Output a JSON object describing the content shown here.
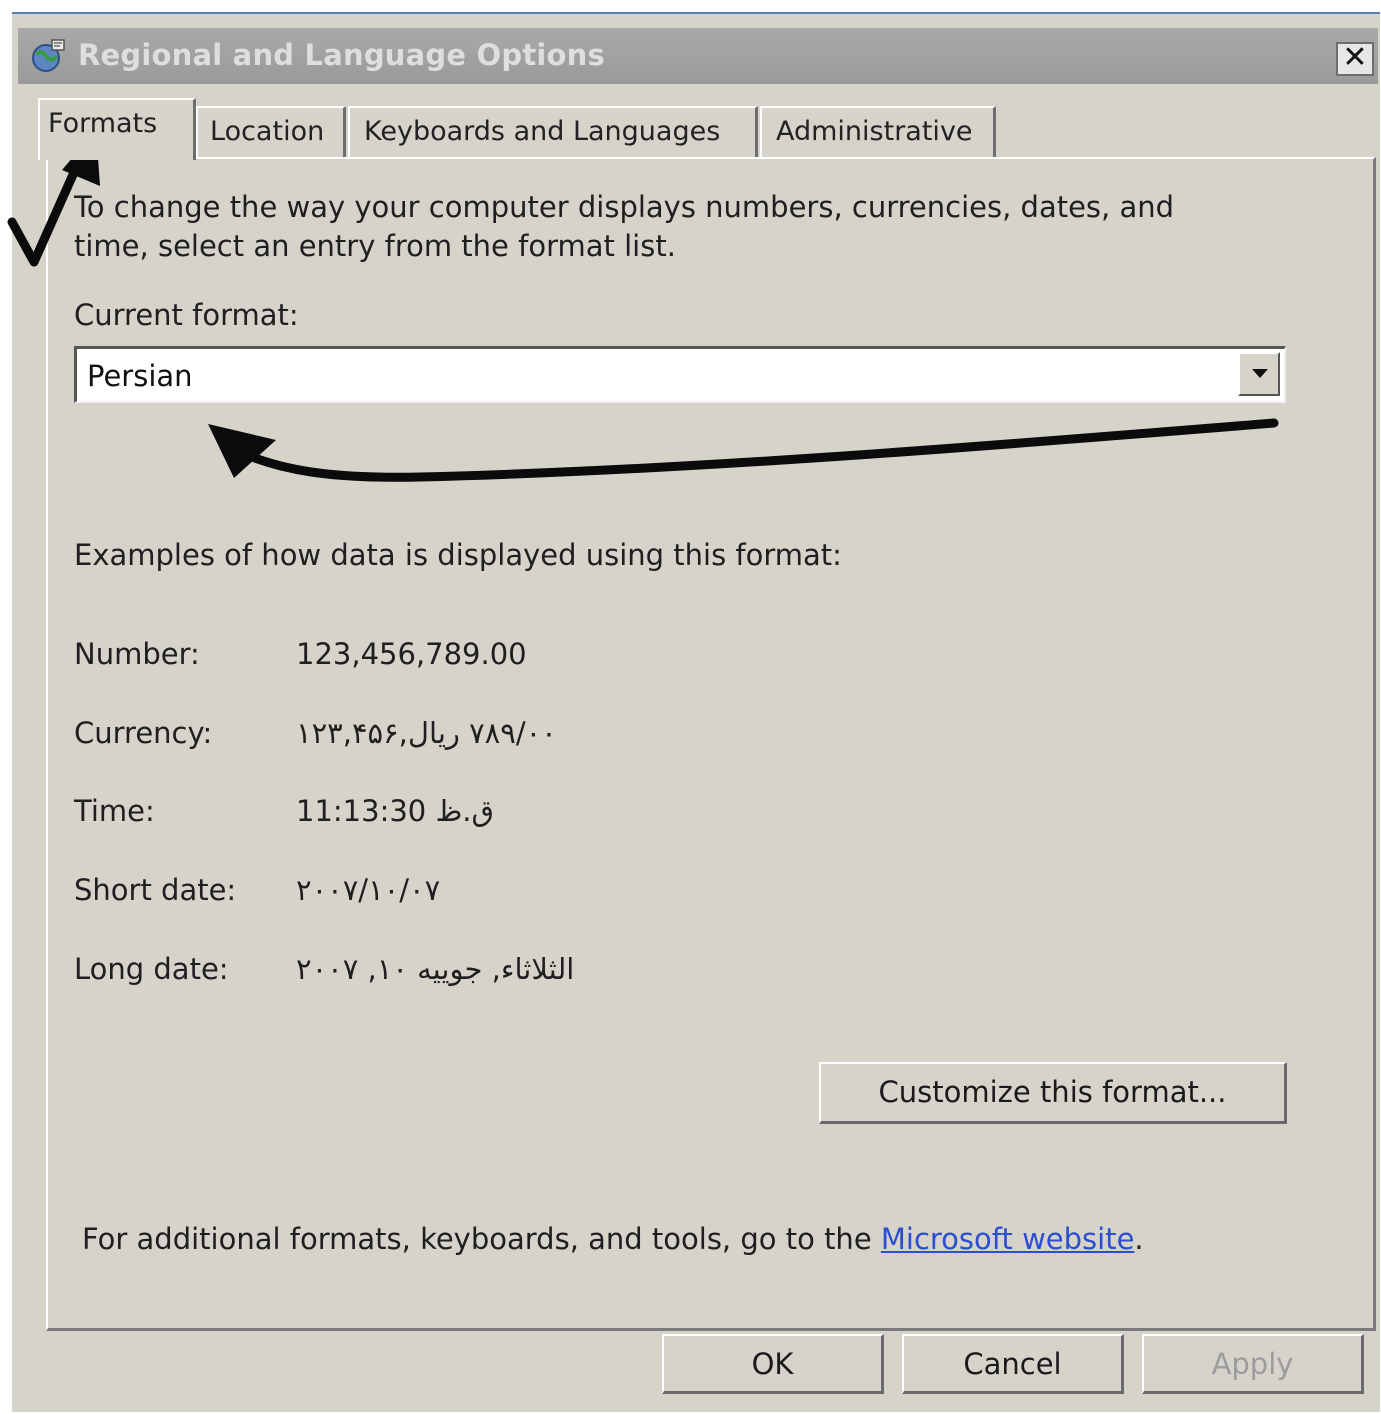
{
  "window": {
    "title": "Regional and Language Options",
    "close_label": "✕"
  },
  "tabs": [
    {
      "label": "Formats",
      "active": true
    },
    {
      "label": "Location",
      "active": false
    },
    {
      "label": "Keyboards and Languages",
      "active": false
    },
    {
      "label": "Administrative",
      "active": false
    }
  ],
  "formats": {
    "intro": [
      "To change the way your computer displays numbers, currencies, dates, and",
      "time, select an entry from the format list."
    ],
    "current_format_label": "Current format:",
    "current_format_value": "Persian",
    "examples_heading": "Examples of how data is displayed using this format:",
    "examples": [
      {
        "label": "Number:",
        "value": "123,456,789.00"
      },
      {
        "label": "Currency:",
        "value": "١٢٣,۴۵۶,٧٨٩/٠٠ ریال"
      },
      {
        "label": "Time:",
        "value": "11:13:30 ق.ظ"
      },
      {
        "label": "Short date:",
        "value": "٢٠٠٧/١٠/٠٧"
      },
      {
        "label": "Long date:",
        "value": "الثلاثاء, جوییه ١٠, ٢٠٠٧"
      }
    ],
    "customize_label": "Customize this format...",
    "footer_prefix": "For additional formats, keyboards, and tools, go to the ",
    "footer_link": "Microsoft website",
    "footer_suffix": "."
  },
  "buttons": {
    "ok": "OK",
    "cancel": "Cancel",
    "apply": "Apply",
    "apply_disabled": true
  },
  "icons": {
    "title_icon": "globe-icon",
    "dropdown_icon": "dropdown-arrow-icon"
  }
}
